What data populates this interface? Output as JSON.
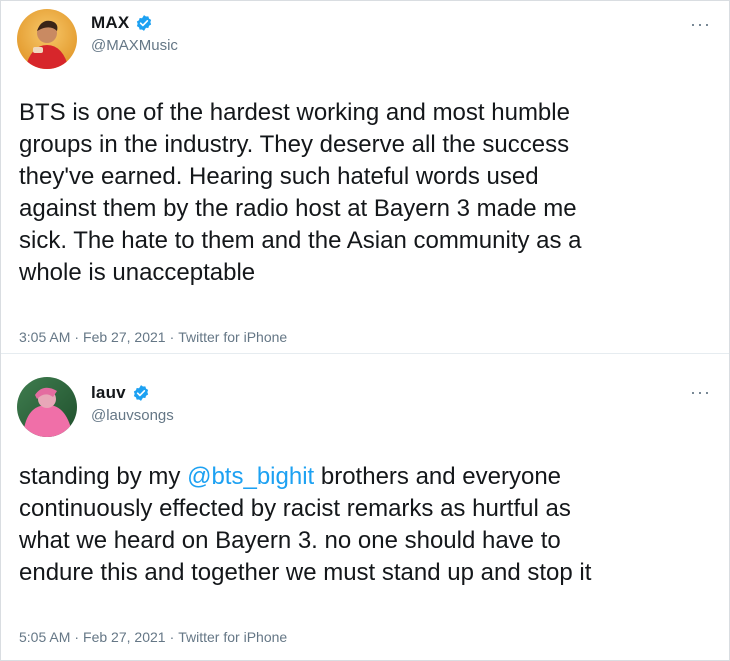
{
  "tweets": [
    {
      "display_name": "MAX",
      "handle": "@MAXMusic",
      "more_label": "···",
      "text": "BTS is one of the hardest working and most humble\ngroups in the industry. They deserve all the success\nthey've earned. Hearing such hateful words used\nagainst them by the radio host at Bayern 3 made me\nsick. The hate to them and the Asian community as a\nwhole is unacceptable",
      "time": "3:05 AM",
      "date": "Feb 27, 2021",
      "source": "Twitter for iPhone",
      "separator": "·",
      "avatar_icon": "avatar-photo-icon",
      "verified_icon": "verified-badge-icon"
    },
    {
      "display_name": "lauv",
      "handle": "@lauvsongs",
      "more_label": "···",
      "text_before_mention": "standing by my ",
      "mention": "@bts_bighit",
      "text_after_mention": " brothers and everyone\ncontinuously effected by racist remarks as hurtful as\nwhat we heard on Bayern 3. no one should have to\nendure this and together we must stand up and stop it",
      "time": "5:05 AM",
      "date": "Feb 27, 2021",
      "source": "Twitter for iPhone",
      "separator": "·",
      "avatar_icon": "avatar-photo-icon",
      "verified_icon": "verified-badge-icon"
    }
  ],
  "colors": {
    "text": "#14171a",
    "secondary": "#657786",
    "link": "#1da1f2",
    "verified": "#1da1f2",
    "divider": "#e6ecf0"
  }
}
